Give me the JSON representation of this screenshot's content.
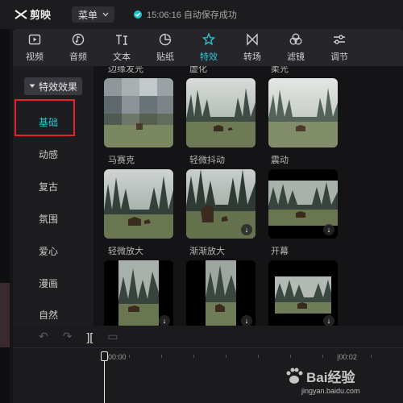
{
  "app": {
    "name": "剪映"
  },
  "titlebar": {
    "menu_label": "菜单",
    "save_status": "15:06:16 自动保存成功"
  },
  "tabs": [
    {
      "label": "视频",
      "icon": "video-icon"
    },
    {
      "label": "音频",
      "icon": "audio-icon"
    },
    {
      "label": "文本",
      "icon": "text-icon"
    },
    {
      "label": "贴纸",
      "icon": "sticker-icon"
    },
    {
      "label": "特效",
      "icon": "effects-icon",
      "active": true
    },
    {
      "label": "转场",
      "icon": "transition-icon"
    },
    {
      "label": "滤镜",
      "icon": "filter-icon"
    },
    {
      "label": "调节",
      "icon": "adjust-icon"
    }
  ],
  "sidebar": {
    "header": "特效效果",
    "items": [
      "基础",
      "动感",
      "复古",
      "氛围",
      "爱心",
      "漫画",
      "自然"
    ],
    "selected": "基础"
  },
  "effects": {
    "row0_labels": [
      "边缘发光",
      "虚化",
      "柔光"
    ],
    "row1_labels": [
      "马赛克",
      "轻微抖动",
      "震动"
    ],
    "row2_labels": [
      "轻微放大",
      "渐渐放大",
      "开幕"
    ]
  },
  "timeline": {
    "time_start": "00:00",
    "time_next": "|00:02"
  },
  "watermark": {
    "text": "Bai经验",
    "sub": "jingyan.baidu.com"
  },
  "colors": {
    "accent": "#2ac8d6",
    "highlight": "#e3242b"
  }
}
